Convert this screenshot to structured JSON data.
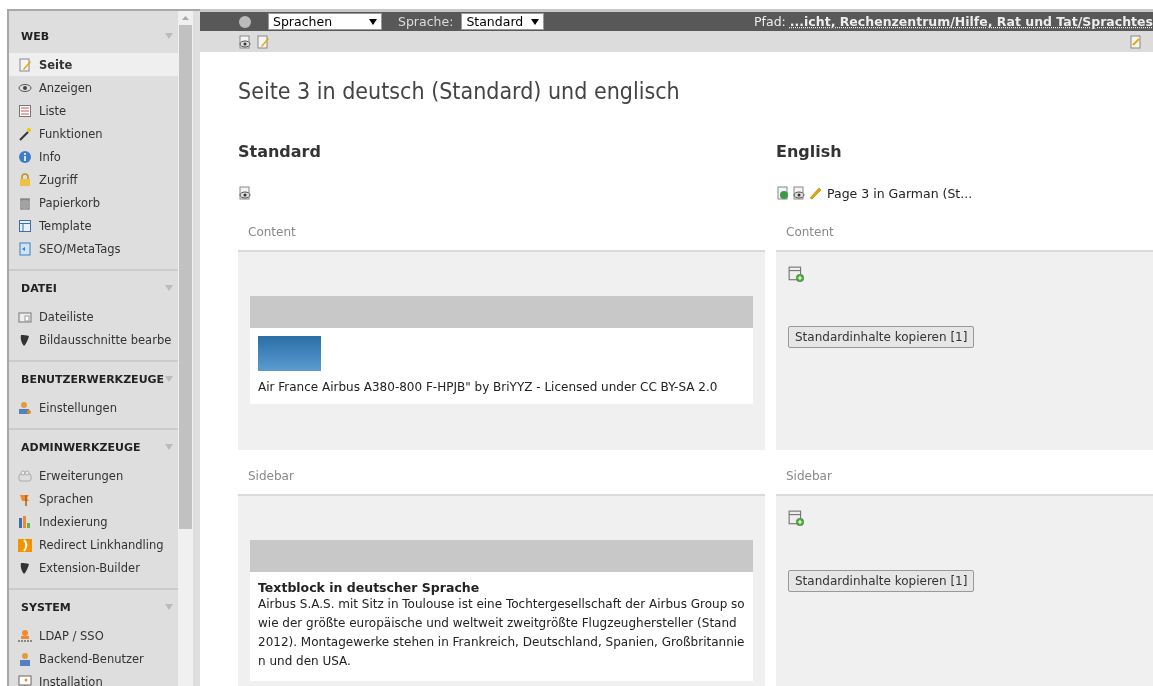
{
  "sidebar": {
    "sections": [
      {
        "title": "WEB",
        "items": [
          {
            "label": "Seite",
            "selected": true
          },
          {
            "label": "Anzeigen",
            "selected": false
          },
          {
            "label": "Liste",
            "selected": false
          },
          {
            "label": "Funktionen",
            "selected": false
          },
          {
            "label": "Info",
            "selected": false
          },
          {
            "label": "Zugriff",
            "selected": false
          },
          {
            "label": "Papierkorb",
            "selected": false
          },
          {
            "label": "Template",
            "selected": false
          },
          {
            "label": "SEO/MetaTags",
            "selected": false
          }
        ]
      },
      {
        "title": "DATEI",
        "items": [
          {
            "label": "Dateiliste",
            "selected": false
          },
          {
            "label": "Bildausschnitte bearbe",
            "selected": false
          }
        ]
      },
      {
        "title": "BENUTZERWERKZEUGE",
        "items": [
          {
            "label": "Einstellungen",
            "selected": false
          }
        ]
      },
      {
        "title": "ADMINWERKZEUGE",
        "items": [
          {
            "label": "Erweiterungen",
            "selected": false
          },
          {
            "label": "Sprachen",
            "selected": false
          },
          {
            "label": "Indexierung",
            "selected": false
          },
          {
            "label": "Redirect Linkhandling",
            "selected": false
          },
          {
            "label": "Extension-Builder",
            "selected": false
          }
        ]
      },
      {
        "title": "SYSTEM",
        "items": [
          {
            "label": "LDAP / SSO",
            "selected": false
          },
          {
            "label": "Backend-Benutzer",
            "selected": false
          },
          {
            "label": "Installation",
            "selected": false
          }
        ]
      }
    ]
  },
  "topbar": {
    "module_select": "Sprachen",
    "language_label": "Sprache:",
    "language_select": "Standard",
    "path_label": "Pfad:",
    "path": "...icht, Rechenzentrum/Hilfe, Rat und Tat/Sprachtes"
  },
  "page_title": "Seite 3 in deutsch (Standard) und englisch",
  "columns": [
    {
      "kind": "default",
      "heading": "Standard",
      "areas": [
        {
          "label": "Content",
          "records": [
            {
              "kind": "image",
              "caption": "Air France Airbus A380-800 F-HPJB\" by BriYYZ - Licensed under CC BY-SA 2.0"
            }
          ]
        },
        {
          "label": "Sidebar",
          "records": [
            {
              "kind": "text",
              "title": "Textblock in deutscher Sprache",
              "body": "Airbus S.A.S. mit Sitz in Toulouse ist eine Tochtergesellschaft der Airbus Group so wie der größte europäische und weltweit zweitgrößte Flugzeughersteller (Stand 2012). Montagewerke stehen in Frankreich, Deutschland, Spanien, Großbritannien und den USA."
            }
          ]
        }
      ]
    },
    {
      "kind": "translation",
      "heading": "English",
      "page_link": "Page 3 in Garman (St...",
      "areas": [
        {
          "label": "Content",
          "copy_button": "Standardinhalte kopieren [1]"
        },
        {
          "label": "Sidebar",
          "copy_button": "Standardinhalte kopieren [1]"
        }
      ]
    }
  ]
}
